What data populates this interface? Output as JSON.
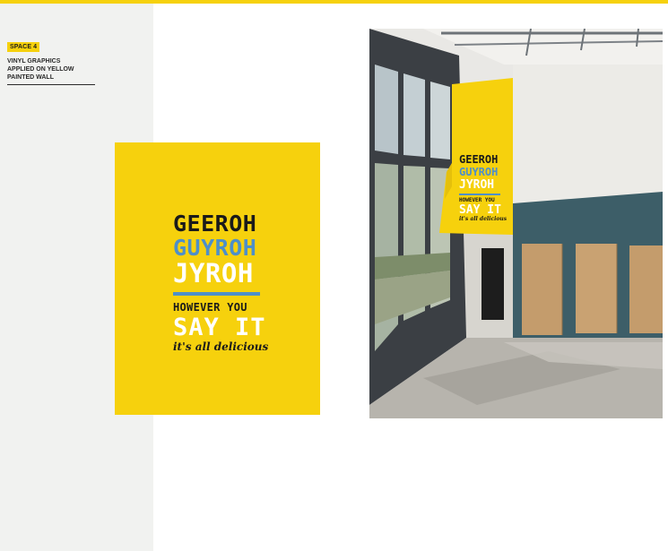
{
  "sidebar": {
    "badge": "SPACE 4",
    "description": "VINYL GRAPHICS\nAPPLIED ON YELLOW\nPAINTED WALL"
  },
  "poster": {
    "line1": "GEEROH",
    "line2": "GUYROH",
    "line3": "JYROH",
    "line4": "HOWEVER YOU",
    "line5": "SAY IT",
    "line6": "it's all delicious"
  },
  "colors": {
    "accent_yellow": "#f6d10d",
    "accent_blue": "#4e8fc9",
    "wall_teal": "#3d5e68",
    "sidebar_bg": "#f1f2f0"
  }
}
